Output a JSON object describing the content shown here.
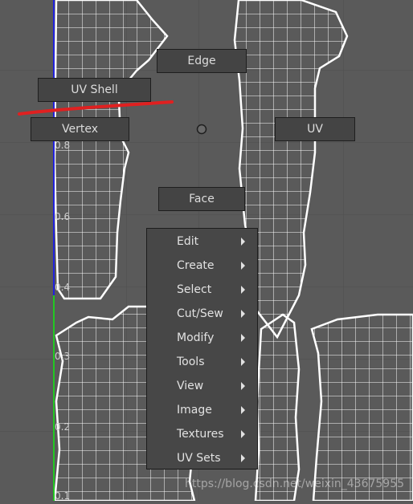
{
  "marking_menu": {
    "north": "Edge",
    "northwest": "UV Shell",
    "west": "Vertex",
    "east": "UV",
    "south": "Face"
  },
  "axis_labels": [
    "0.8",
    "0.6",
    "0.4",
    "0.3",
    "0.2",
    "0.1"
  ],
  "context_menu": {
    "items": [
      {
        "label": "Edit"
      },
      {
        "label": "Create"
      },
      {
        "label": "Select"
      },
      {
        "label": "Cut/Sew"
      },
      {
        "label": "Modify"
      },
      {
        "label": "Tools"
      },
      {
        "label": "View"
      },
      {
        "label": "Image"
      },
      {
        "label": "Textures"
      },
      {
        "label": "UV Sets"
      }
    ]
  },
  "annotation_color": "#e02020",
  "watermark": "https://blog.csdn.net/weixin_43675955"
}
